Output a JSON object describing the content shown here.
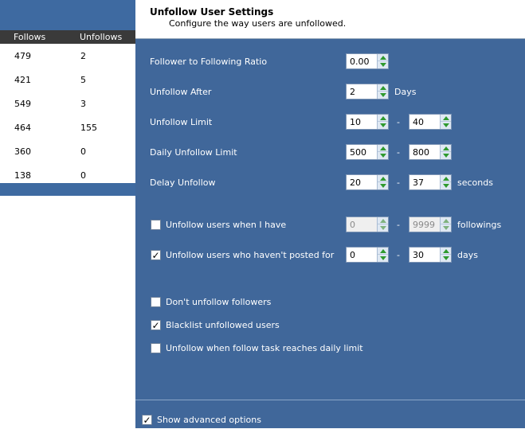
{
  "left_table": {
    "headers": [
      "Follows",
      "Unfollows"
    ],
    "rows": [
      {
        "follows": "479",
        "unfollows": "2"
      },
      {
        "follows": "421",
        "unfollows": "5"
      },
      {
        "follows": "549",
        "unfollows": "3"
      },
      {
        "follows": "464",
        "unfollows": "155"
      },
      {
        "follows": "360",
        "unfollows": "0"
      },
      {
        "follows": "138",
        "unfollows": "0"
      }
    ]
  },
  "dialog": {
    "title": "Unfollow User Settings",
    "subtitle": "Configure the way users are unfollowed."
  },
  "settings": {
    "ratio": {
      "label": "Follower to Following Ratio",
      "value": "0.00"
    },
    "unfollow_after": {
      "label": "Unfollow After",
      "value": "2",
      "unit": "Days"
    },
    "unfollow_limit": {
      "label": "Unfollow Limit",
      "min": "10",
      "max": "40",
      "dash": "-"
    },
    "daily_unfollow_limit": {
      "label": "Daily Unfollow Limit",
      "min": "500",
      "max": "800",
      "dash": "-"
    },
    "delay_unfollow": {
      "label": "Delay Unfollow",
      "min": "20",
      "max": "37",
      "dash": "-",
      "unit": "seconds"
    },
    "when_i_have": {
      "label": "Unfollow users when I have",
      "checked": false,
      "min": "0",
      "max": "9999",
      "dash": "-",
      "unit": "followings"
    },
    "havent_posted": {
      "label": "Unfollow users who haven't posted for",
      "checked": true,
      "min": "0",
      "max": "30",
      "dash": "-",
      "unit": "days"
    },
    "dont_unfollow_followers": {
      "label": "Don't unfollow followers",
      "checked": false
    },
    "blacklist_unfollowed": {
      "label": "Blacklist unfollowed users",
      "checked": true
    },
    "unfollow_daily_limit": {
      "label": "Unfollow when follow task reaches daily limit",
      "checked": false
    }
  },
  "footer": {
    "advanced": {
      "label": "Show advanced options",
      "checked": true
    }
  },
  "check_glyph": "✓",
  "colors": {
    "dialog_bg": "#40679a",
    "header_dark": "#3a3a3a",
    "spin_arrow": "#2f9a2f"
  }
}
